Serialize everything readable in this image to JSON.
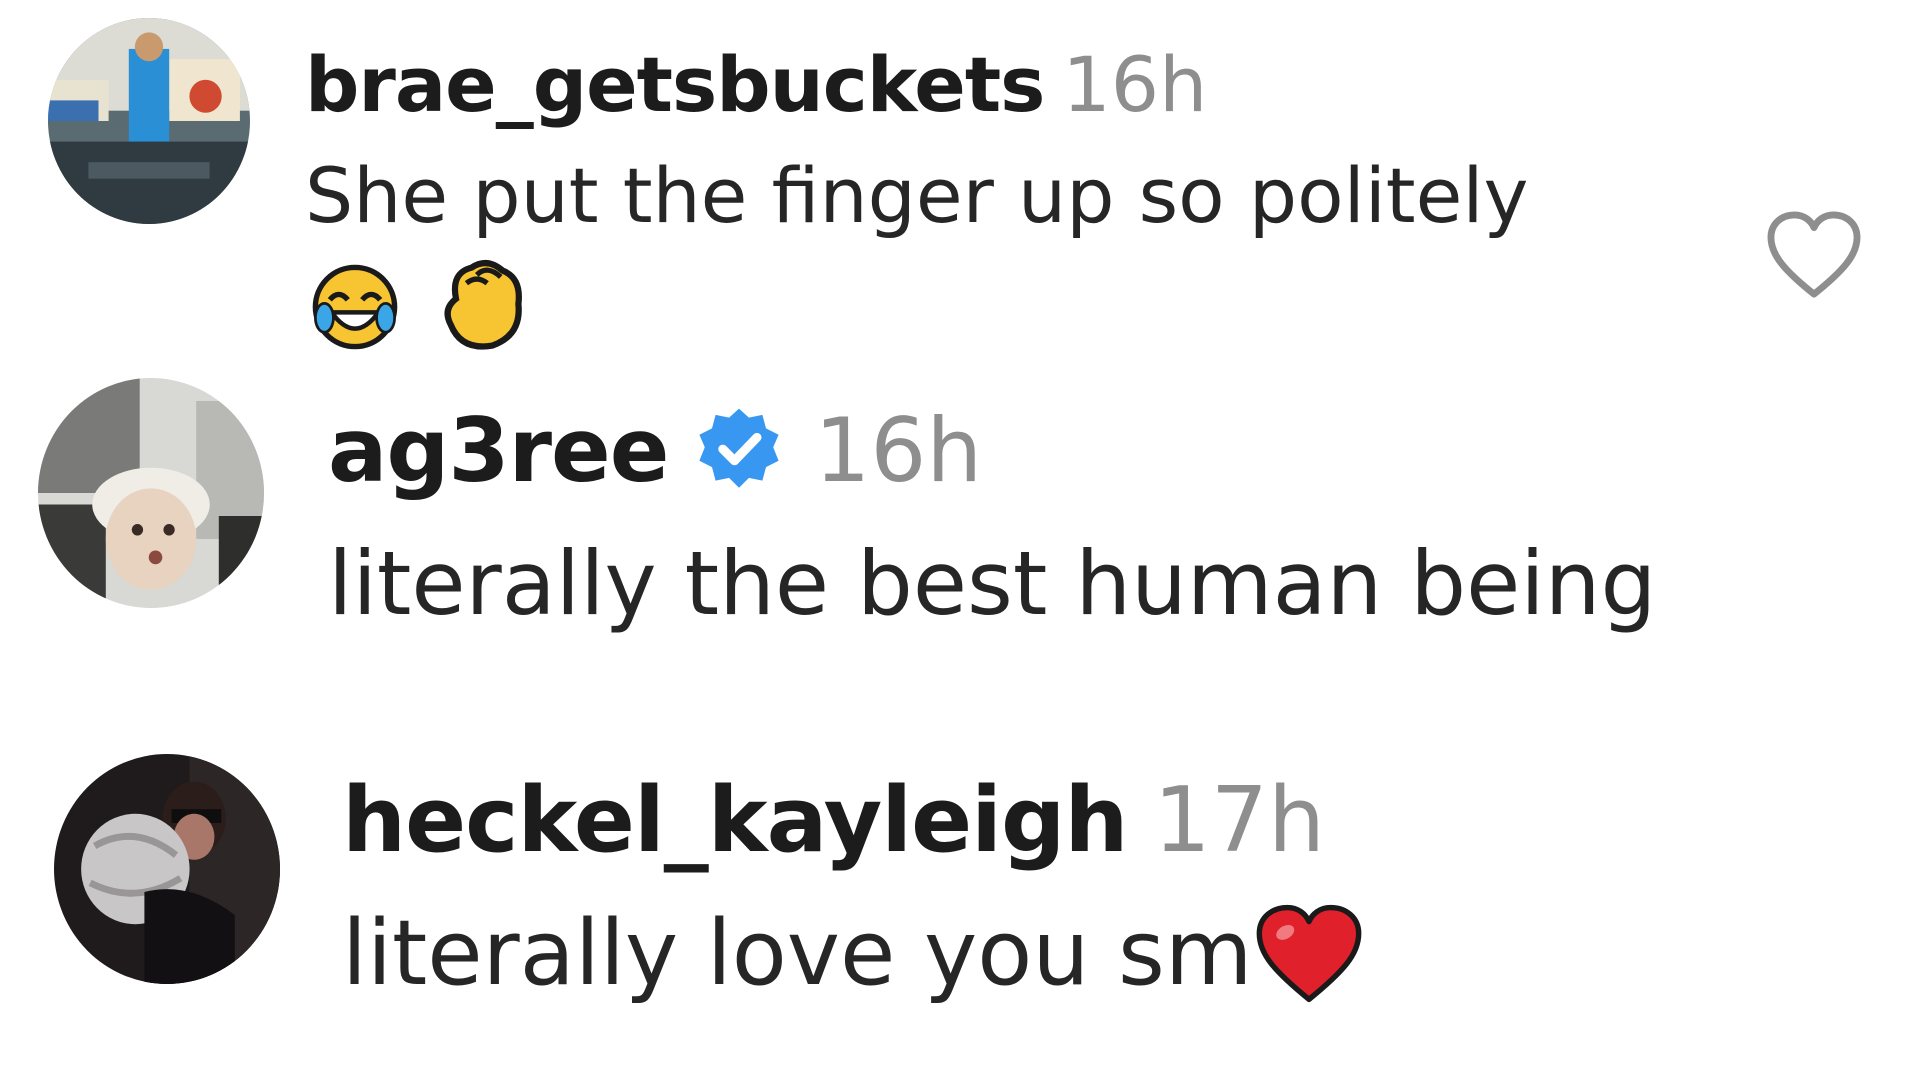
{
  "comments": [
    {
      "username": "brae_getsbuckets",
      "time": "16h",
      "text": "She put the finger up so politely",
      "emojis": [
        "face-with-tears-of-joy",
        "clapping-hands"
      ],
      "verified": false,
      "liked": false
    },
    {
      "username": "ag3ree",
      "time": "16h",
      "text": "literally the best human being",
      "verified": true
    },
    {
      "username": "heckel_kayleigh",
      "time": "17h",
      "text": "literally love you sm",
      "emojis": [
        "red-heart"
      ],
      "verified": false
    }
  ],
  "colors": {
    "username": "#1c1c1c",
    "time": "#8e8e8e",
    "text": "#262626",
    "verified_badge": "#3897f0",
    "heart_outline": "#8e8e8e",
    "red_heart": "#e0202a"
  }
}
